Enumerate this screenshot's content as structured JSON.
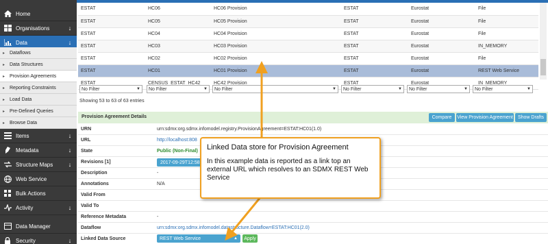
{
  "sidebar": {
    "items": [
      {
        "label": "Home",
        "icon": "home-icon",
        "arrow": ""
      },
      {
        "label": "Organisations",
        "icon": "organisations-icon",
        "arrow": "↓"
      },
      {
        "label": "Data",
        "icon": "chart-icon",
        "arrow": "↓"
      },
      {
        "label": "Items",
        "icon": "items-icon",
        "arrow": "↓"
      },
      {
        "label": "Metadata",
        "icon": "metadata-icon",
        "arrow": "↓"
      },
      {
        "label": "Structure Maps",
        "icon": "structure-maps-icon",
        "arrow": "↓"
      },
      {
        "label": "Web Service",
        "icon": "globe-icon",
        "arrow": ""
      },
      {
        "label": "Bulk Actions",
        "icon": "bulk-actions-icon",
        "arrow": ""
      },
      {
        "label": "Activity",
        "icon": "activity-icon",
        "arrow": "↓"
      },
      {
        "label": "Data Manager",
        "icon": "data-manager-icon",
        "arrow": ""
      },
      {
        "label": "Security",
        "icon": "security-icon",
        "arrow": "↓"
      }
    ],
    "subitems": [
      {
        "label": "Dataflows"
      },
      {
        "label": "Data Structures"
      },
      {
        "label": "Provision Agreements"
      },
      {
        "label": "Reporting Constraints"
      },
      {
        "label": "Load Data"
      },
      {
        "label": "Pre-Defined Queries"
      },
      {
        "label": "Browse Data"
      }
    ]
  },
  "table": {
    "rows": [
      [
        "ESTAT",
        "HC06",
        "HC06 Provision",
        "ESTAT",
        "Eurostat",
        "File"
      ],
      [
        "ESTAT",
        "HC05",
        "HC05 Provision",
        "ESTAT",
        "Eurostat",
        "File"
      ],
      [
        "ESTAT",
        "HC04",
        "HC04 Provision",
        "ESTAT",
        "Eurostat",
        "File"
      ],
      [
        "ESTAT",
        "HC03",
        "HC03 Provision",
        "ESTAT",
        "Eurostat",
        "IN_MEMORY"
      ],
      [
        "ESTAT",
        "HC02",
        "HC02 Provision",
        "ESTAT",
        "Eurostat",
        "File"
      ],
      [
        "ESTAT",
        "HC01",
        "HC01 Provision",
        "ESTAT",
        "Eurostat",
        "REST Web Service"
      ],
      [
        "ESTAT",
        "CENSUS_ESTAT_HC42",
        "HC42 Provision",
        "ESTAT",
        "Eurostat",
        "IN_MEMORY"
      ]
    ],
    "filter_label": "No Filter"
  },
  "showing": "Showing 53 to 63 of 63 entries",
  "details": {
    "title": "Provision Agreement Details",
    "buttons": {
      "compare": "Compare",
      "view": "View Provision Agreement",
      "drafts": "Show Drafts"
    },
    "urn_key": "URN",
    "urn_val": "urn:sdmx:org.sdmx.infomodel.registry.ProvisionAgreement=ESTAT:HC01(1.0)",
    "url_key": "URL",
    "url_val": "http://localhost:808",
    "state_key": "State",
    "state_val": "Public (Non-Final)",
    "revisions_key": "Revisions [1]",
    "revisions_val": "2017-09-29T12:58",
    "description_key": "Description",
    "description_val": "-",
    "annotations_key": "Annotations",
    "annotations_val": "N/A",
    "valid_from_key": "Valid From",
    "valid_to_key": "Valid To",
    "refmeta_key": "Reference Metadata",
    "refmeta_val": "-",
    "dataflow_key": "Dataflow",
    "dataflow_val": "urn:sdmx:org.sdmx.infomodel.datastructure.Dataflow=ESTAT:HC01(2.0)",
    "lds_key": "Linked Data Source",
    "lds_val": "REST Web Service",
    "apply": "Apply"
  },
  "callout": {
    "title": "Linked Data store for Provision Agreement",
    "body": "In this example data is reported as a link top an external URL which resolves to an SDMX REST Web Service"
  },
  "colors": {
    "accent": "#2a6fb5",
    "callout_border": "#f0a020",
    "selected_row": "#a9bcd9",
    "details_header": "#dff0d8"
  }
}
